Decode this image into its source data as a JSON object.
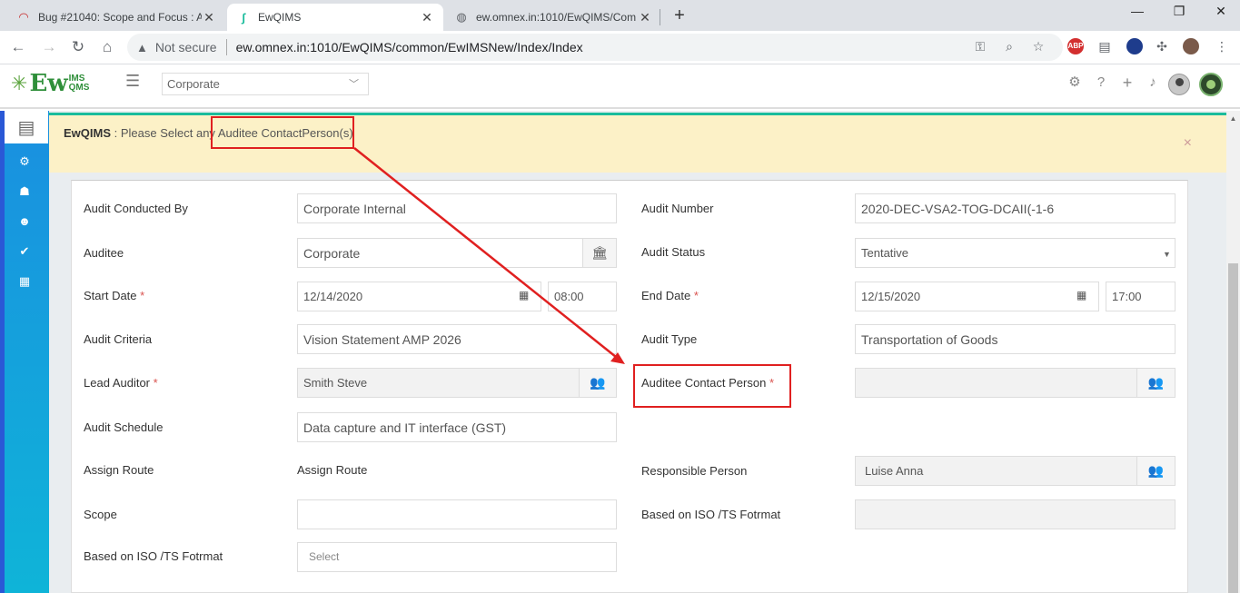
{
  "browser": {
    "tabs": [
      {
        "title": "Bug #21040: Scope and Focus : A",
        "close": "✕"
      },
      {
        "title": "EwQIMS",
        "close": "✕"
      },
      {
        "title": "ew.omnex.in:1010/EwQIMS/Com",
        "close": "✕"
      }
    ],
    "new_tab": "+",
    "window_controls": {
      "minimize": "—",
      "maximize": "❐",
      "close": "✕"
    },
    "security_label": "Not secure",
    "url": "ew.omnex.in:1010/EwQIMS/common/EwIMSNew/Index/Index",
    "abp_label": "ABP"
  },
  "app": {
    "logo": {
      "ew": "Ew",
      "ims": "IMS",
      "qms": "QMS"
    },
    "org_select": "Corporate",
    "colors": {
      "accent": "#1abc9c",
      "sidebar_top": "#1a8fe0",
      "sidebar_bottom": "#0fb4d8",
      "alert_bg": "#fcf1c7",
      "highlight": "#e02020",
      "required": "#d9534f"
    }
  },
  "alert": {
    "brand": "EwQIMS",
    "separator": " : ",
    "message": "Please Select any Auditee ContactPerson(s)",
    "close": "×"
  },
  "form": {
    "required_mark": "*",
    "audit_conducted_by": {
      "label": "Audit Conducted By",
      "value": "Corporate Internal"
    },
    "audit_number": {
      "label": "Audit Number",
      "value": "2020-DEC-VSA2-TOG-DCAII(-1-6"
    },
    "auditee": {
      "label": "Auditee",
      "value": "Corporate"
    },
    "audit_status": {
      "label": "Audit Status",
      "value": "Tentative"
    },
    "start_date": {
      "label": "Start Date",
      "date": "12/14/2020",
      "time": "08:00"
    },
    "end_date": {
      "label": "End Date",
      "date": "12/15/2020",
      "time": "17:00"
    },
    "audit_criteria": {
      "label": "Audit Criteria",
      "value": "Vision Statement AMP 2026"
    },
    "audit_type": {
      "label": "Audit Type",
      "value": "Transportation of Goods"
    },
    "lead_auditor": {
      "label": "Lead Auditor",
      "value": "Smith Steve"
    },
    "auditee_contact_person": {
      "label": "Auditee Contact Person",
      "value": ""
    },
    "audit_schedule": {
      "label": "Audit Schedule",
      "value": "Data capture and IT interface (GST)"
    },
    "assign_route": {
      "label": "Assign Route",
      "value": "Assign Route"
    },
    "responsible_person": {
      "label": "Responsible Person",
      "value": "Luise Anna"
    },
    "scope": {
      "label": "Scope",
      "value": ""
    },
    "based_on_iso_right": {
      "label": "Based on ISO /TS Fotrmat",
      "value": ""
    },
    "based_on_iso_left": {
      "label": "Based on ISO /TS Fotrmat",
      "placeholder": "Select"
    }
  }
}
